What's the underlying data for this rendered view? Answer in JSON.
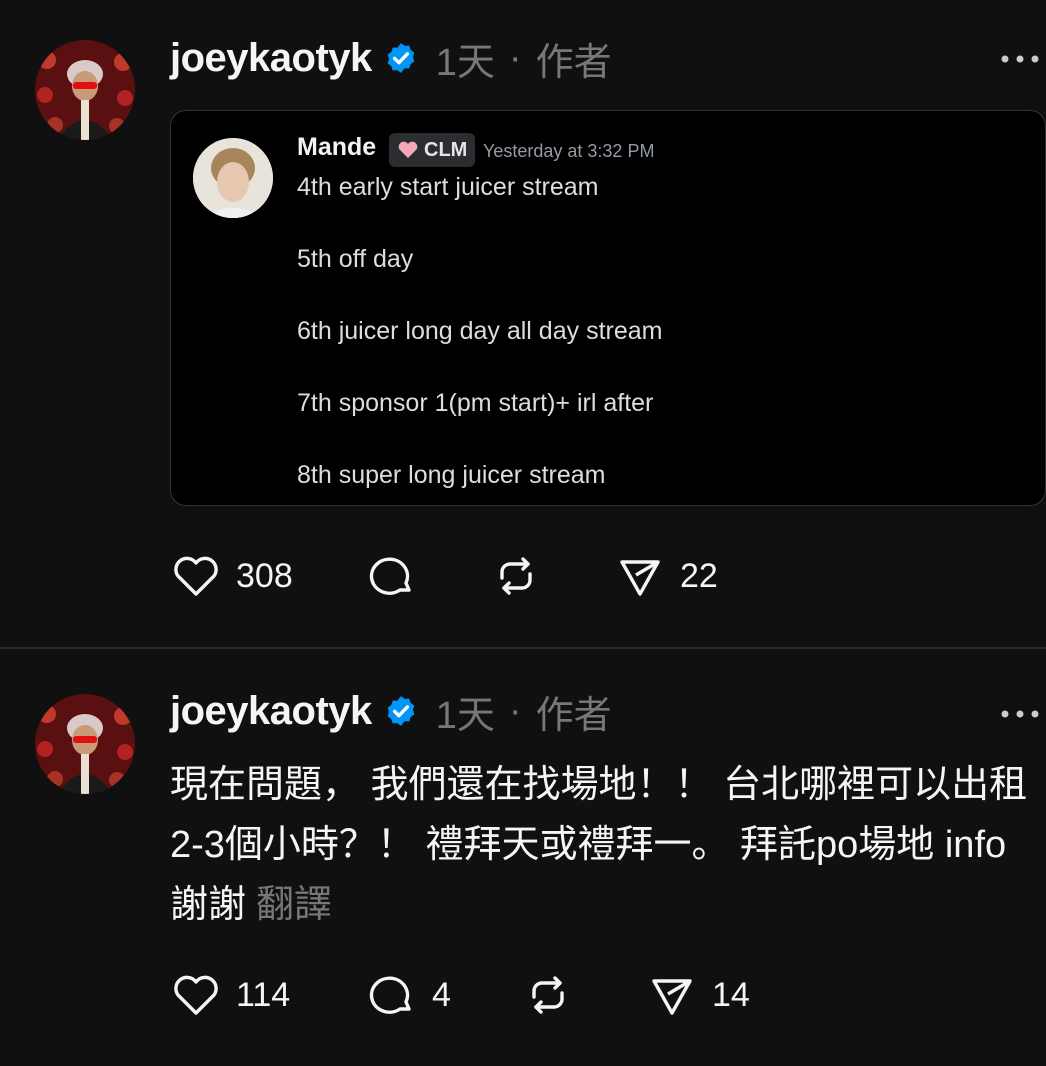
{
  "posts": [
    {
      "username": "joeykaotyk",
      "time": "1天",
      "separator": "·",
      "role": "作者",
      "embed": {
        "name": "Mande",
        "badge": "CLM",
        "timestamp": "Yesterday at 3:32 PM",
        "lines": [
          "4th early start juicer stream",
          "5th off day",
          "6th juicer long day all day stream",
          "7th sponsor 1(pm start)+ irl after",
          "8th super long juicer stream"
        ]
      },
      "likes": "308",
      "shares": "22"
    },
    {
      "username": "joeykaotyk",
      "time": "1天",
      "separator": "·",
      "role": "作者",
      "text": "現在問題， 我們還在找場地！！ 台北哪裡可以出租2-3個小時？！ 禮拜天或禮拜一。 拜託po場地 info 謝謝",
      "translate": "翻譯",
      "likes": "114",
      "replies": "4",
      "shares": "14"
    }
  ],
  "icons": {
    "verified": "verified-badge-icon",
    "more": "more-icon",
    "like": "heart-icon",
    "reply": "comment-icon",
    "repost": "repost-icon",
    "share": "send-icon"
  },
  "colors": {
    "background": "#101010",
    "text": "#f3f5f7",
    "muted": "#777777",
    "verified": "#0095f6"
  }
}
